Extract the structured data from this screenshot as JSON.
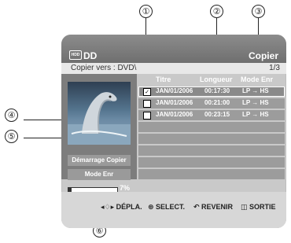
{
  "callouts": [
    "①",
    "②",
    "③",
    "④",
    "⑤",
    "⑥"
  ],
  "title_bar": {
    "hdd_label": "HDD",
    "title": "DD",
    "right": "Copier"
  },
  "sub_bar": {
    "destination": "Copier vers : DVD\\",
    "page": "1/3"
  },
  "panel": {
    "copy_button": "Démarrage Copier",
    "mode_button": "Mode Enr",
    "progress_percent": 7,
    "progress_label": "7%"
  },
  "table": {
    "headers": [
      "Titre",
      "Longueur",
      "Mode Enr"
    ],
    "rows": [
      {
        "checked": true,
        "check_glyph": "✓",
        "date": "JAN/01/2006",
        "length": "00:17:30",
        "mode": "LP → HS"
      },
      {
        "checked": false,
        "check_glyph": "",
        "date": "JAN/01/2006",
        "length": "00:21:00",
        "mode": "LP → HS"
      },
      {
        "checked": false,
        "check_glyph": "",
        "date": "JAN/01/2006",
        "length": "00:23:15",
        "mode": "LP → HS"
      }
    ]
  },
  "footer": {
    "move": "◂♢▸ DÉPLA.",
    "select": "⊛ SELECT.",
    "back": "↶ REVENIR",
    "exit": "◫ SORTIE"
  }
}
